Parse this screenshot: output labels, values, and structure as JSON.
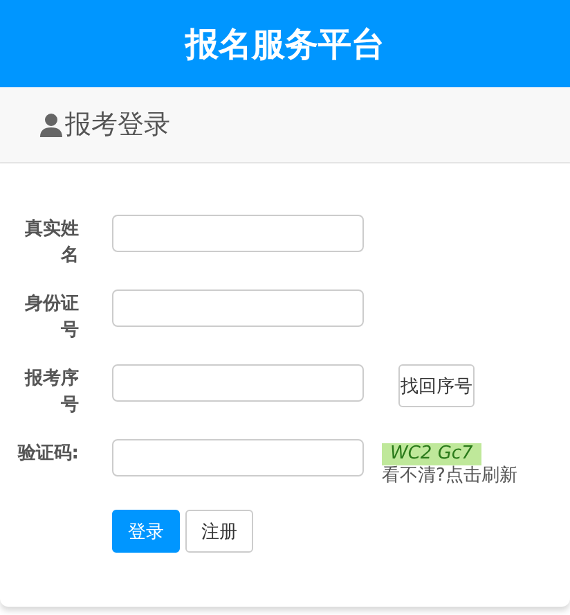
{
  "header": {
    "title": "报名服务平台"
  },
  "panel": {
    "title": "报考登录"
  },
  "fields": [
    {
      "label": "真实姓名",
      "kind": "text"
    },
    {
      "label": "身份证号",
      "kind": "text"
    },
    {
      "label": "报考序号",
      "kind": "text",
      "action": "找回序号"
    },
    {
      "label": "验证码:",
      "kind": "captcha",
      "captcha": "WC2 Gc7",
      "hint": "看不清?点击刷新"
    }
  ],
  "buttons": [
    {
      "label": "登录",
      "kind": "primary"
    },
    {
      "label": "注册",
      "kind": "default"
    }
  ]
}
